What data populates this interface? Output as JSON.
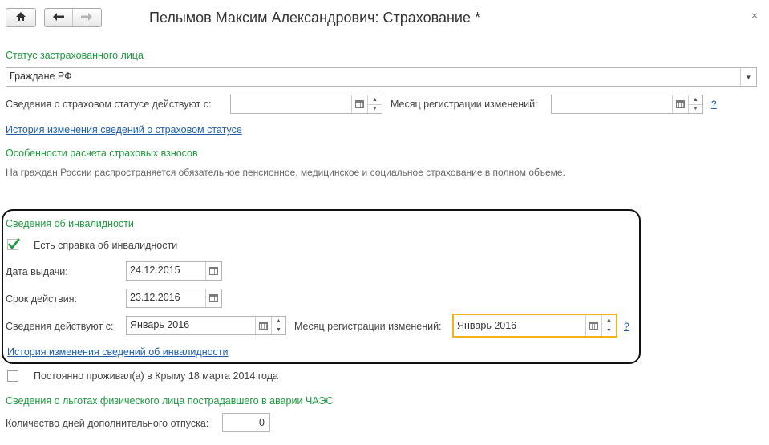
{
  "window": {
    "title": "Пелымов Максим Александрович: Страхование *",
    "close_glyph": "×"
  },
  "insured_status": {
    "heading": "Статус застрахованного лица",
    "value": "Граждане РФ",
    "effective_from_label": "Сведения о страховом статусе действуют с:",
    "effective_from_value": "",
    "month_reg_label": "Месяц регистрации изменений:",
    "month_reg_value": "",
    "help": "?",
    "history_link": "История изменения сведений о страховом статусе"
  },
  "calc_features": {
    "heading": "Особенности расчета страховых взносов",
    "note": "На граждан России распространяется обязательное пенсионное, медицинское и социальное страхование в полном объеме."
  },
  "disability": {
    "heading": "Сведения об инвалидности",
    "has_certificate_label": "Есть справка об инвалидности",
    "has_certificate_checked": true,
    "issue_date_label": "Дата выдачи:",
    "issue_date_value": "24.12.2015",
    "valid_until_label": "Срок действия:",
    "valid_until_value": "23.12.2016",
    "effective_from_label": "Сведения действуют с:",
    "effective_from_value": "Январь 2016",
    "month_reg_label": "Месяц регистрации изменений:",
    "month_reg_value": "Январь 2016",
    "help": "?",
    "history_link": "История изменения сведений об инвалидности"
  },
  "crimea": {
    "label": "Постоянно проживал(а) в Крыму 18 марта 2014 года",
    "checked": false
  },
  "chaes": {
    "heading": "Сведения о льготах физического лица пострадавшего в аварии ЧАЭС",
    "extra_days_label": "Количество дней дополнительного отпуска:",
    "extra_days_value": "0"
  },
  "colors": {
    "heading_green": "#1d9a3e",
    "link_blue": "#1f5fa8",
    "focus_border": "#f2b21a"
  },
  "icons": [
    "home-icon",
    "back-arrow-icon",
    "forward-arrow-icon",
    "close-icon",
    "calendar-icon",
    "spin-up-icon",
    "spin-down-icon",
    "dropdown-arrow-icon",
    "checkmark-icon"
  ]
}
